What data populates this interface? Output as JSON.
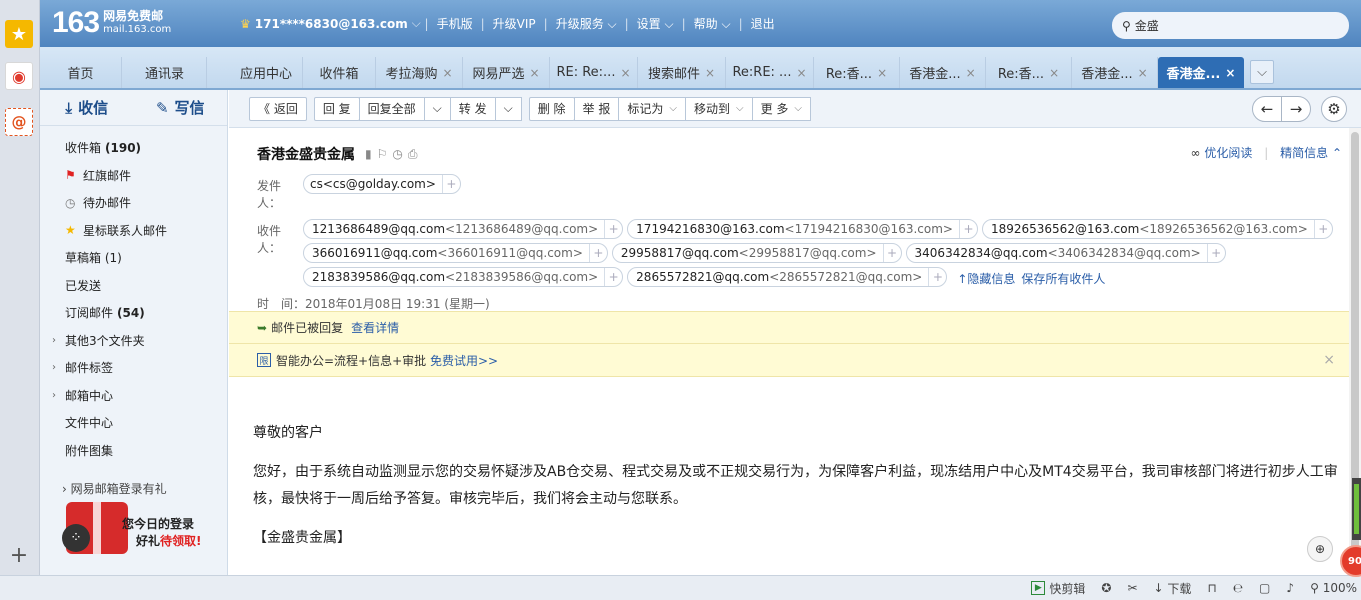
{
  "brand": {
    "logo_number": "163",
    "logo_name": "网易免费邮",
    "logo_domain": "mail.163.com"
  },
  "userbar": {
    "account": "171****6830@163.com",
    "links": [
      "手机版",
      "升级VIP",
      "升级服务",
      "设置",
      "帮助",
      "退出"
    ]
  },
  "search": {
    "value": "金盛"
  },
  "tabs": [
    {
      "label": "首页",
      "closable": false
    },
    {
      "label": "通讯录",
      "closable": false
    },
    {
      "label": "应用中心",
      "closable": false
    },
    {
      "label": "收件箱",
      "closable": false
    },
    {
      "label": "考拉海购",
      "closable": true
    },
    {
      "label": "网易严选",
      "closable": true
    },
    {
      "label": "RE: Re:...",
      "closable": true
    },
    {
      "label": "搜索邮件",
      "closable": true
    },
    {
      "label": "Re:RE: ...",
      "closable": true
    },
    {
      "label": "Re:香...",
      "closable": true
    },
    {
      "label": "香港金...",
      "closable": true
    },
    {
      "label": "Re:香...",
      "closable": true
    },
    {
      "label": "香港金...",
      "closable": true
    },
    {
      "label": "香港金...",
      "closable": true,
      "active": true
    }
  ],
  "sidebar": {
    "receive": "收信",
    "write": "写信",
    "items": [
      {
        "label": "收件箱",
        "count": "(190)",
        "icon": ""
      },
      {
        "label": "红旗邮件",
        "count": "",
        "icon": "red-flag-icon"
      },
      {
        "label": "待办邮件",
        "count": "",
        "icon": "clock-icon"
      },
      {
        "label": "星标联系人邮件",
        "count": "",
        "icon": "star-icon"
      },
      {
        "label": "草稿箱 (1)",
        "count": "",
        "icon": ""
      },
      {
        "label": "已发送",
        "count": "",
        "icon": ""
      },
      {
        "label": "订阅邮件",
        "count": "(54)",
        "icon": ""
      },
      {
        "label": "其他3个文件夹",
        "count": "",
        "icon": "",
        "expandable": true
      },
      {
        "label": "邮件标签",
        "count": "",
        "icon": "",
        "expandable": true
      },
      {
        "label": "邮箱中心",
        "count": "",
        "icon": "",
        "expandable": true
      },
      {
        "label": "文件中心",
        "count": "",
        "icon": ""
      },
      {
        "label": "附件图集",
        "count": "",
        "icon": ""
      }
    ],
    "promo": {
      "title": "› 网易邮箱登录有礼",
      "line1": "您今日的登录",
      "line2a": "好礼",
      "line2b": "待领取!"
    }
  },
  "toolbar": {
    "back": "《 返回",
    "reply": "回 复",
    "reply_all": "回复全部",
    "forward": "转 发",
    "delete": "删 除",
    "report": "举 报",
    "mark_as": "标记为",
    "move_to": "移动到",
    "more": "更 多"
  },
  "email": {
    "subject": "香港金盛贵金属",
    "optimize_read": "优化阅读",
    "brief_info": "精简信息",
    "from_label": "发件人：",
    "from": {
      "name": "cs",
      "addr": "<cs@golday.com>"
    },
    "to_label": "收件人：",
    "to": [
      {
        "name": "1213686489@qq.com",
        "addr": "<1213686489@qq.com>"
      },
      {
        "name": "17194216830@163.com",
        "addr": "<17194216830@163.com>"
      },
      {
        "name": "18926536562@163.com",
        "addr": "<18926536562@163.com>"
      },
      {
        "name": "366016911@qq.com",
        "addr": "<366016911@qq.com>"
      },
      {
        "name": "29958817@qq.com",
        "addr": "<29958817@qq.com>"
      },
      {
        "name": "3406342834@qq.com",
        "addr": "<3406342834@qq.com>"
      },
      {
        "name": "2183839586@qq.com",
        "addr": "<2183839586@qq.com>"
      },
      {
        "name": "2865572821@qq.com",
        "addr": "<2865572821@qq.com>"
      }
    ],
    "hide_info": "↑隐藏信息",
    "save_all": "保存所有收件人",
    "time": "时　间：2018年01月08日 19:31 (星期一)",
    "notice_replied": "邮件已被回复",
    "notice_details": "查看详情",
    "promo_text": "智能办公=流程+信息+审批",
    "promo_link": "免费试用>>",
    "greeting": "尊敬的客户",
    "paragraph": "您好，由于系统自动监测显示您的交易怀疑涉及AB仓交易、程式交易及或不正规交易行为，为保障客户利益，现冻结用户中心及MT4交易平台，我司审核部门将进行初步人工审核，最快将于一周后给予答复。审核完毕后，我们将会主动与您联系。",
    "signature": "【金盛贵金属】"
  },
  "statusbar": {
    "items": [
      "快剪辑",
      "下载",
      "100%"
    ]
  },
  "badge": "90",
  "colors": {
    "accent": "#2e6db4",
    "header_gradient_top": "#7aa9d7",
    "notice_bg": "#fffbd4"
  }
}
